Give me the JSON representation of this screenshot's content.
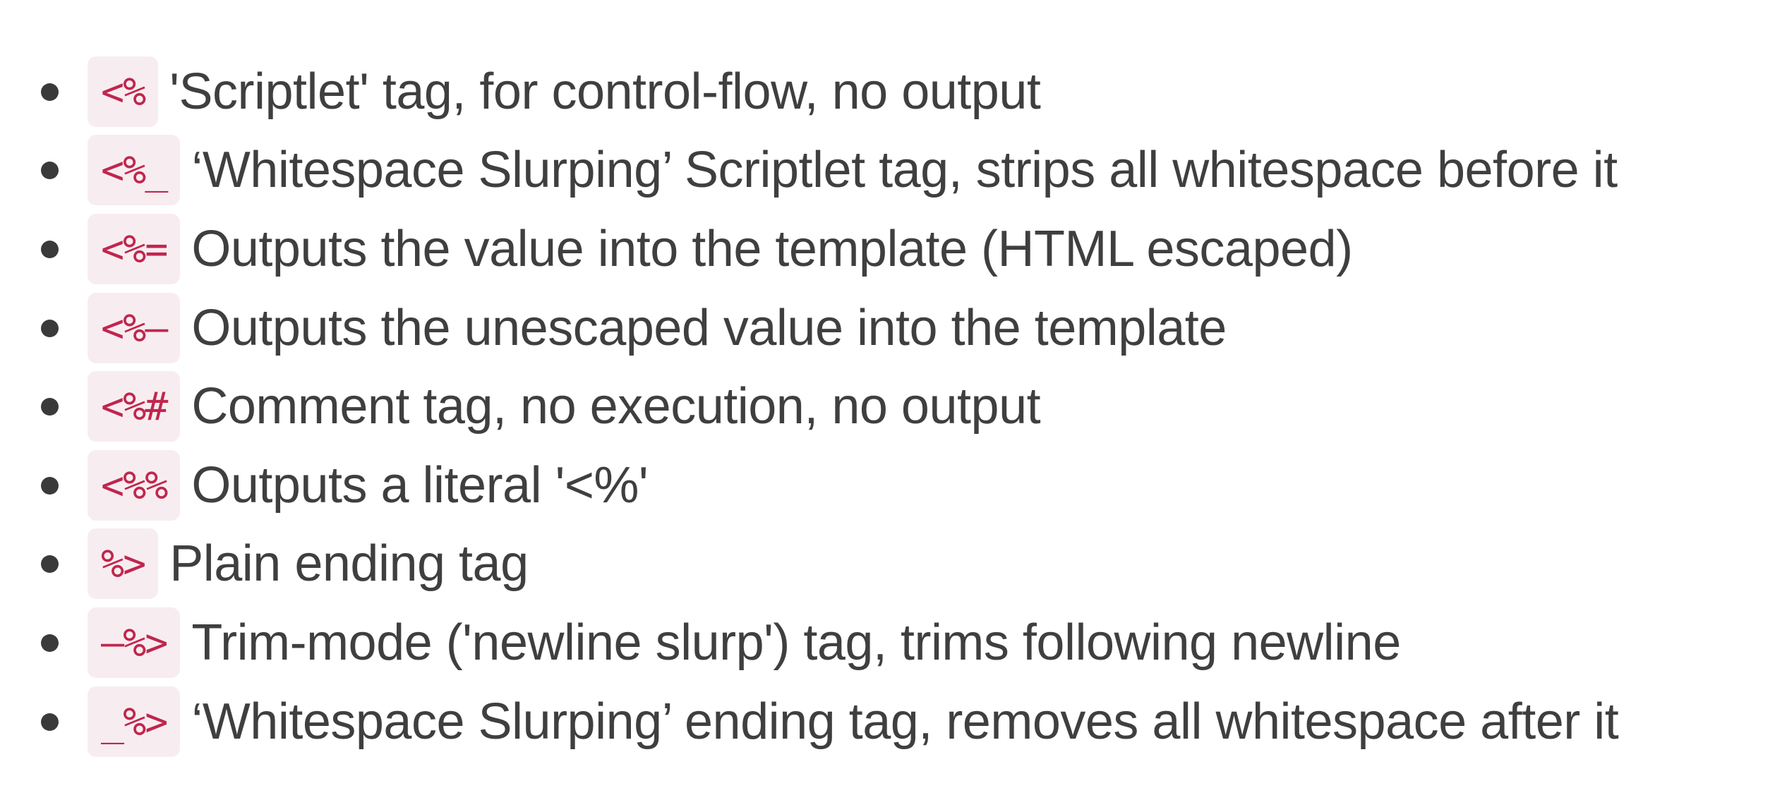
{
  "items": [
    {
      "code": "<%",
      "desc": "'Scriptlet' tag, for control-flow, no output"
    },
    {
      "code": "<%_",
      "desc": "‘Whitespace Slurping’ Scriptlet tag, strips all whitespace before it"
    },
    {
      "code": "<%=",
      "desc": "Outputs the value into the template (HTML escaped)"
    },
    {
      "code": "<%–",
      "desc": "Outputs the unescaped value into the template"
    },
    {
      "code": "<%#",
      "desc": "Comment tag, no execution, no output"
    },
    {
      "code": "<%%",
      "desc": "Outputs a literal '<%'"
    },
    {
      "code": "%>",
      "desc": "Plain ending tag"
    },
    {
      "code": "–%>",
      "desc": "Trim-mode ('newline slurp') tag, trims following newline"
    },
    {
      "code": "_%>",
      "desc": "‘Whitespace Slurping’ ending tag, removes all whitespace after it"
    }
  ],
  "colors": {
    "text": "#3f3f3f",
    "code_text": "#c0264e",
    "code_background": "#f7edf0",
    "bullet": "#3a3a3a"
  }
}
